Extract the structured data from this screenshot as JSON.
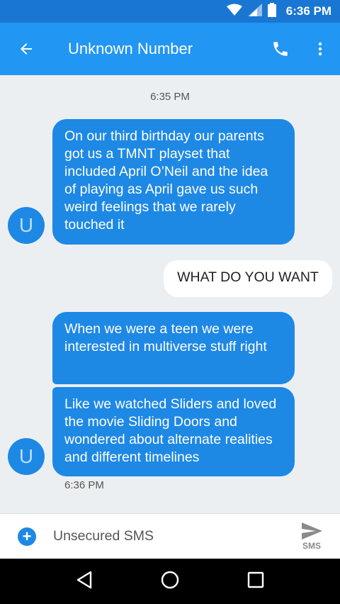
{
  "status_bar": {
    "time": "6:36 PM",
    "icons": [
      "wifi-icon",
      "signal-icon",
      "battery-icon"
    ]
  },
  "app_bar": {
    "title": "Unknown Number",
    "icons": [
      "back-arrow-icon",
      "phone-icon",
      "more-vert-icon"
    ]
  },
  "conversation": {
    "top_timestamp": "6:35 PM",
    "messages": [
      {
        "direction": "incoming",
        "text": "On our third birthday our parents got us a TMNT playset that included April O’Neil and the idea of playing as April gave us such weird feelings that we rarely touched it"
      },
      {
        "direction": "outgoing",
        "text": "WHAT DO YOU WANT"
      },
      {
        "direction": "incoming",
        "text": "When we were a teen we were interested in multiverse stuff right"
      },
      {
        "direction": "incoming",
        "text": "Like we watched Sliders and loved the movie Sliding Doors and wondered about alternate realities and different timelines"
      }
    ],
    "avatar_letter": "U",
    "bottom_timestamp": "6:36 PM"
  },
  "compose": {
    "placeholder": "Unsecured SMS",
    "send_label": "SMS"
  },
  "colors": {
    "status_bar": "#1976D2",
    "app_bar": "#2196F3",
    "bubble_incoming": "#1E88E5",
    "background": "#ECEFF1"
  }
}
